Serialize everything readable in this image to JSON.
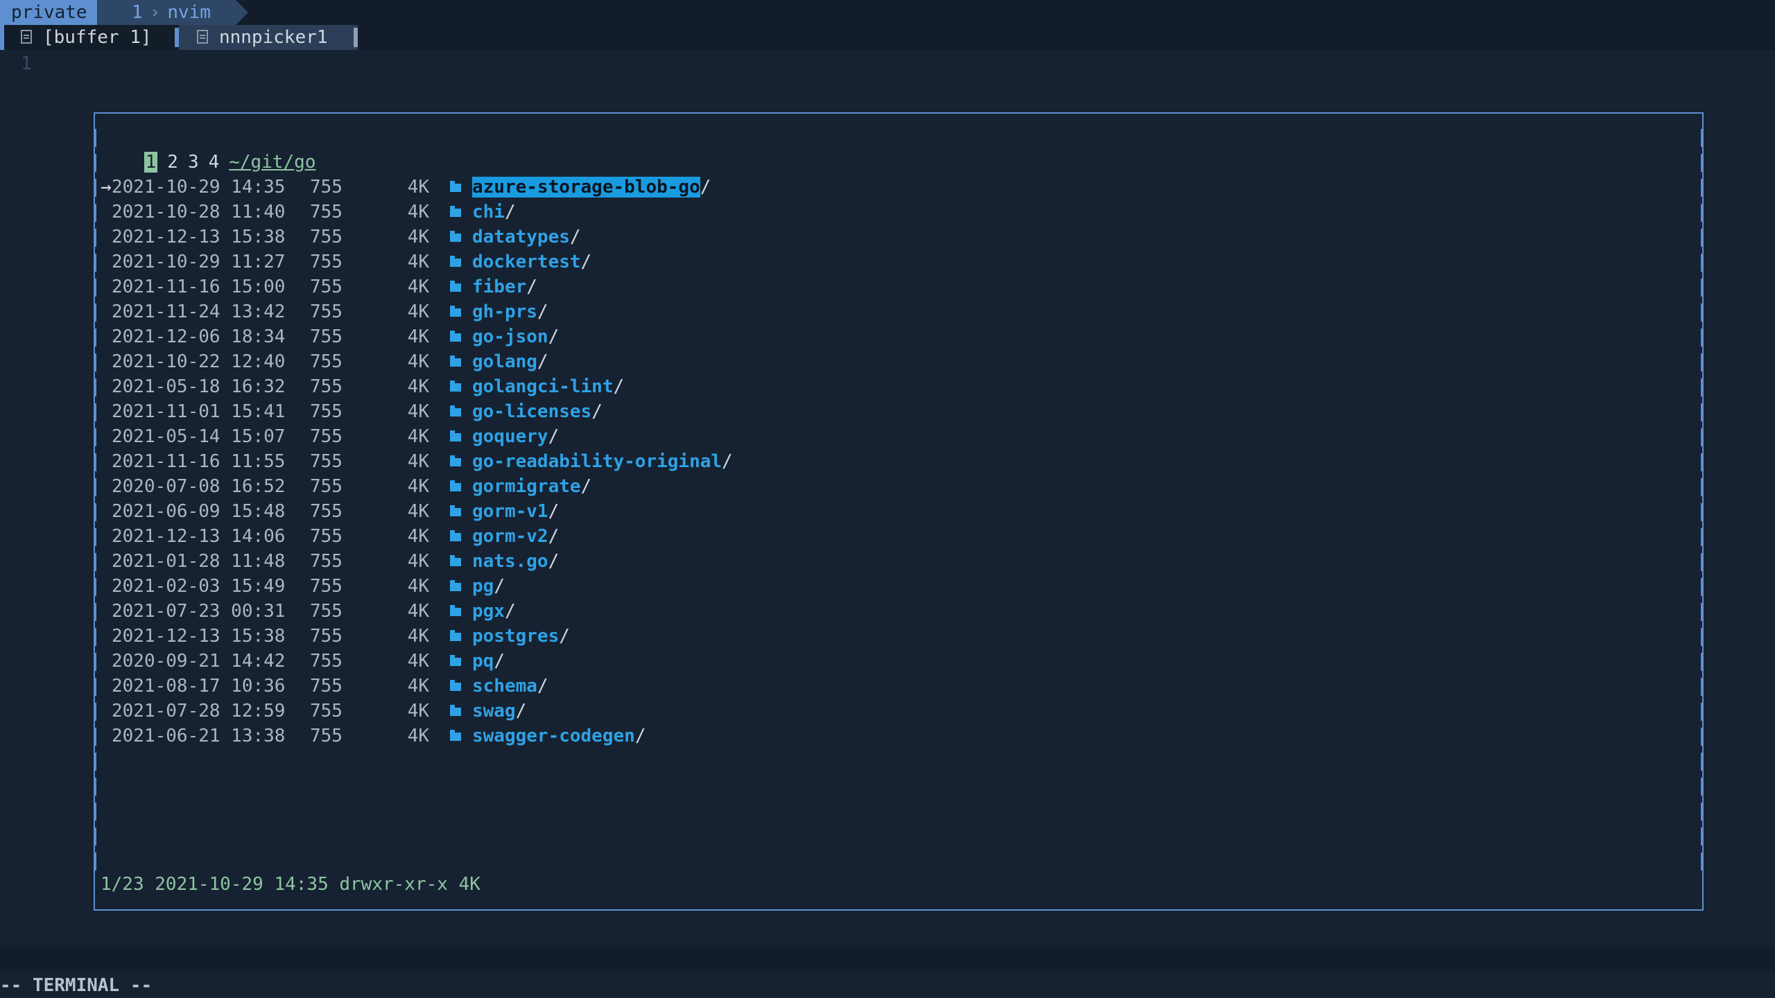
{
  "tmux": {
    "session": "private",
    "window_index": "1",
    "window_name": "nvim"
  },
  "tabs": [
    {
      "label": "[buffer 1]"
    },
    {
      "label": "nnnpicker1"
    }
  ],
  "editor": {
    "line_number": "1"
  },
  "nnn": {
    "contexts": [
      "1",
      "2",
      "3",
      "4"
    ],
    "active_context": "1",
    "cwd": "~/git/go",
    "entries": [
      {
        "date": "2021-10-29 14:35",
        "perm": "755",
        "size": "4K",
        "name": "azure-storage-blob-go",
        "selected": true
      },
      {
        "date": "2021-10-28 11:40",
        "perm": "755",
        "size": "4K",
        "name": "chi"
      },
      {
        "date": "2021-12-13 15:38",
        "perm": "755",
        "size": "4K",
        "name": "datatypes"
      },
      {
        "date": "2021-10-29 11:27",
        "perm": "755",
        "size": "4K",
        "name": "dockertest"
      },
      {
        "date": "2021-11-16 15:00",
        "perm": "755",
        "size": "4K",
        "name": "fiber"
      },
      {
        "date": "2021-11-24 13:42",
        "perm": "755",
        "size": "4K",
        "name": "gh-prs"
      },
      {
        "date": "2021-12-06 18:34",
        "perm": "755",
        "size": "4K",
        "name": "go-json"
      },
      {
        "date": "2021-10-22 12:40",
        "perm": "755",
        "size": "4K",
        "name": "golang"
      },
      {
        "date": "2021-05-18 16:32",
        "perm": "755",
        "size": "4K",
        "name": "golangci-lint"
      },
      {
        "date": "2021-11-01 15:41",
        "perm": "755",
        "size": "4K",
        "name": "go-licenses"
      },
      {
        "date": "2021-05-14 15:07",
        "perm": "755",
        "size": "4K",
        "name": "goquery"
      },
      {
        "date": "2021-11-16 11:55",
        "perm": "755",
        "size": "4K",
        "name": "go-readability-original"
      },
      {
        "date": "2020-07-08 16:52",
        "perm": "755",
        "size": "4K",
        "name": "gormigrate"
      },
      {
        "date": "2021-06-09 15:48",
        "perm": "755",
        "size": "4K",
        "name": "gorm-v1"
      },
      {
        "date": "2021-12-13 14:06",
        "perm": "755",
        "size": "4K",
        "name": "gorm-v2"
      },
      {
        "date": "2021-01-28 11:48",
        "perm": "755",
        "size": "4K",
        "name": "nats.go"
      },
      {
        "date": "2021-02-03 15:49",
        "perm": "755",
        "size": "4K",
        "name": "pg"
      },
      {
        "date": "2021-07-23 00:31",
        "perm": "755",
        "size": "4K",
        "name": "pgx"
      },
      {
        "date": "2021-12-13 15:38",
        "perm": "755",
        "size": "4K",
        "name": "postgres"
      },
      {
        "date": "2020-09-21 14:42",
        "perm": "755",
        "size": "4K",
        "name": "pq"
      },
      {
        "date": "2021-08-17 10:36",
        "perm": "755",
        "size": "4K",
        "name": "schema"
      },
      {
        "date": "2021-07-28 12:59",
        "perm": "755",
        "size": "4K",
        "name": "swag"
      },
      {
        "date": "2021-06-21 13:38",
        "perm": "755",
        "size": "4K",
        "name": "swagger-codegen"
      }
    ],
    "status": "1/23 2021-10-29 14:35 drwxr-xr-x 4K"
  },
  "mode": "-- TERMINAL --",
  "colors": {
    "background": "#162231",
    "accent": "#5e8fd0",
    "directory": "#2fa2e6",
    "context_active": "#8fc4a2"
  },
  "icons": {
    "tab": "document-icon",
    "entry": "folder-icon"
  }
}
